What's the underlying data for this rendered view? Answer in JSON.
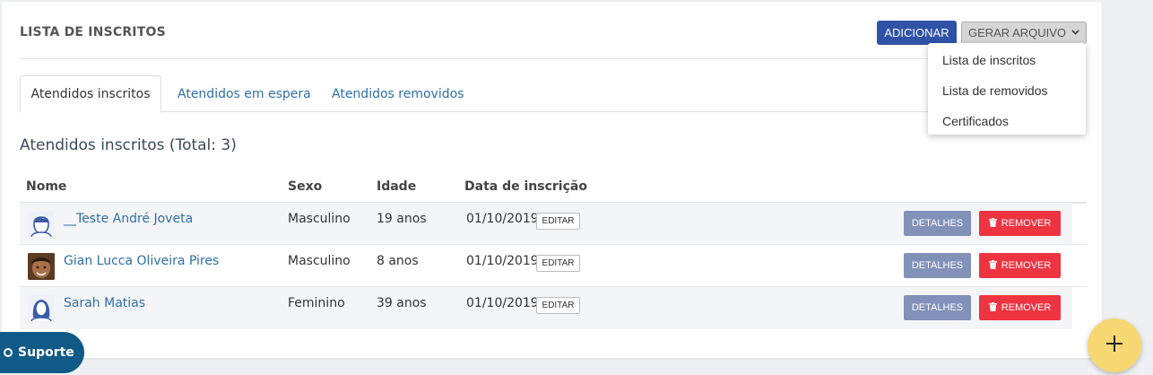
{
  "header": {
    "title": "LISTA DE INSCRITOS",
    "add_label": "ADICIONAR",
    "generate_label": "GERAR ARQUIVO"
  },
  "dropdown": {
    "items": [
      {
        "label": "Lista de inscritos"
      },
      {
        "label": "Lista de removidos"
      },
      {
        "label": "Certificados"
      }
    ]
  },
  "tabs": [
    {
      "label": "Atendidos inscritos",
      "active": true
    },
    {
      "label": "Atendidos em espera",
      "active": false
    },
    {
      "label": "Atendidos removidos",
      "active": false
    }
  ],
  "section": {
    "subtitle": "Atendidos inscritos (Total: 3)"
  },
  "table": {
    "columns": [
      "Nome",
      "Sexo",
      "Idade",
      "Data de inscrição"
    ],
    "edit_label": "EDITAR",
    "details_label": "DETALHES",
    "remove_label": "REMOVER",
    "rows": [
      {
        "name": "__Teste André Joveta",
        "sex": "Masculino",
        "age": "19 anos",
        "date": "01/10/2019",
        "avatar": "male-avatar-icon"
      },
      {
        "name": "Gian Lucca Oliveira Pires",
        "sex": "Masculino",
        "age": "8 anos",
        "date": "01/10/2019",
        "avatar": "photo"
      },
      {
        "name": "Sarah Matias",
        "sex": "Feminino",
        "age": "39 anos",
        "date": "01/10/2019",
        "avatar": "female-avatar-icon"
      }
    ]
  },
  "support": {
    "label": "Suporte"
  },
  "colors": {
    "primary": "#2f52a7",
    "link": "#2e6fa8",
    "danger": "#ee3341",
    "details": "#8191b8",
    "support": "#0f5a87",
    "fab": "#f8d872"
  }
}
